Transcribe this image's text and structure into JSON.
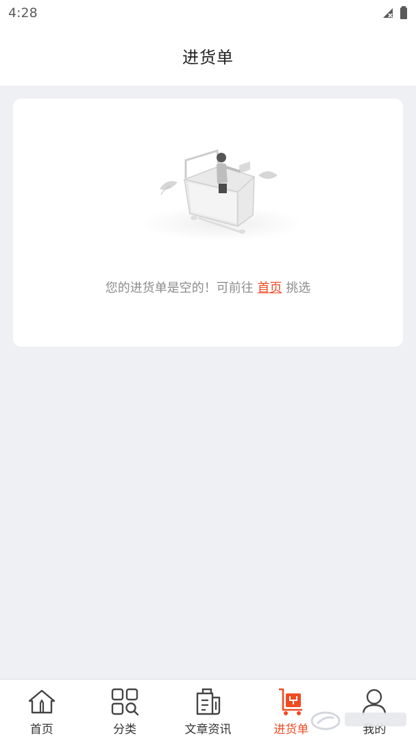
{
  "status_bar": {
    "time": "4:28",
    "icons": [
      "signal-off-icon",
      "battery-icon"
    ]
  },
  "header": {
    "title": "进货单"
  },
  "empty_state": {
    "illustration": "empty-cart-illustration",
    "text_before": "您的进货单是空的！可前往 ",
    "link_text": "首页",
    "text_after": " 挑选"
  },
  "tabbar": {
    "tabs": [
      {
        "label": "首页",
        "icon": "home-icon"
      },
      {
        "label": "分类",
        "icon": "category-icon"
      },
      {
        "label": "文章资讯",
        "icon": "article-icon"
      },
      {
        "label": "进货单",
        "icon": "cart-icon",
        "active": true
      },
      {
        "label": "我的",
        "icon": "profile-icon"
      }
    ]
  },
  "colors": {
    "accent": "#f04b23",
    "background": "#eff0f4",
    "card": "#ffffff"
  }
}
